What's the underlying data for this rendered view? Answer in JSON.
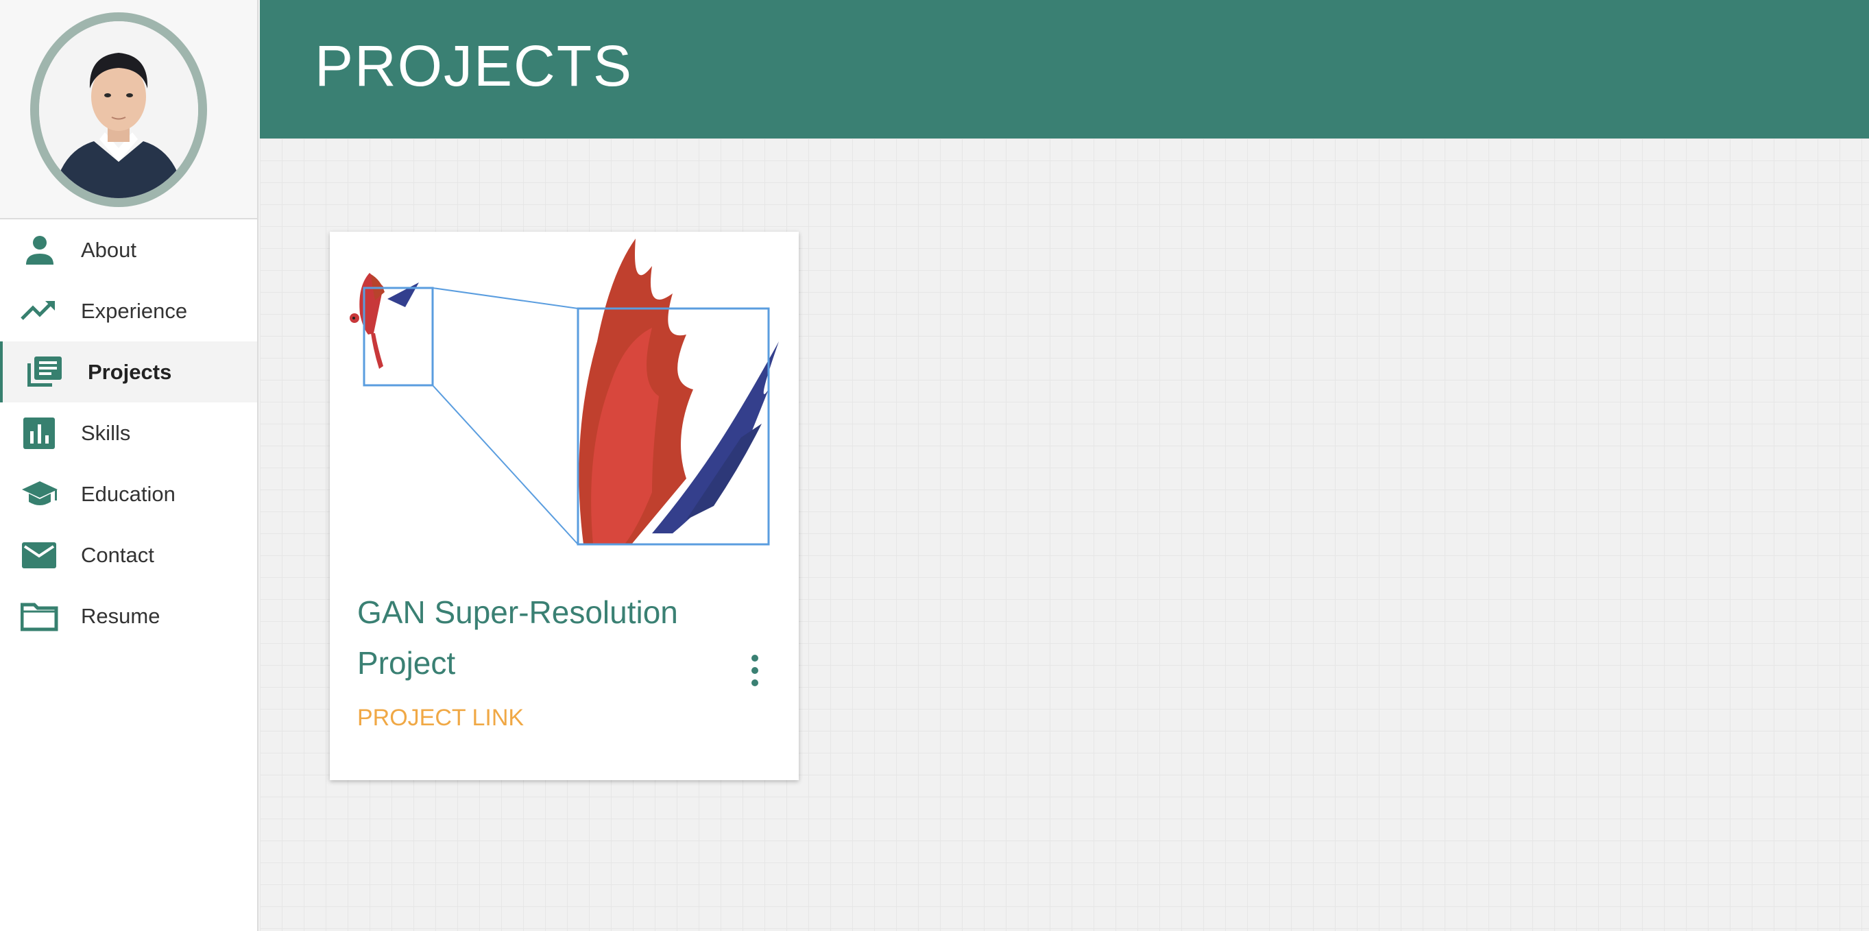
{
  "sidebar": {
    "items": [
      {
        "label": "About",
        "icon": "person-icon"
      },
      {
        "label": "Experience",
        "icon": "trending-up-icon"
      },
      {
        "label": "Projects",
        "icon": "library-books-icon",
        "active": true
      },
      {
        "label": "Skills",
        "icon": "bar-chart-icon"
      },
      {
        "label": "Education",
        "icon": "graduation-cap-icon"
      },
      {
        "label": "Contact",
        "icon": "envelope-icon"
      },
      {
        "label": "Resume",
        "icon": "folder-icon"
      }
    ]
  },
  "header": {
    "title": "PROJECTS"
  },
  "projects": [
    {
      "title": "GAN Super-Resolution Project",
      "link_label": "PROJECT LINK",
      "image": "parrot-zoom-illustration"
    }
  ],
  "colors": {
    "accent": "#3a8073",
    "link": "#f0a845",
    "avatar_border": "#9fb5ad"
  }
}
